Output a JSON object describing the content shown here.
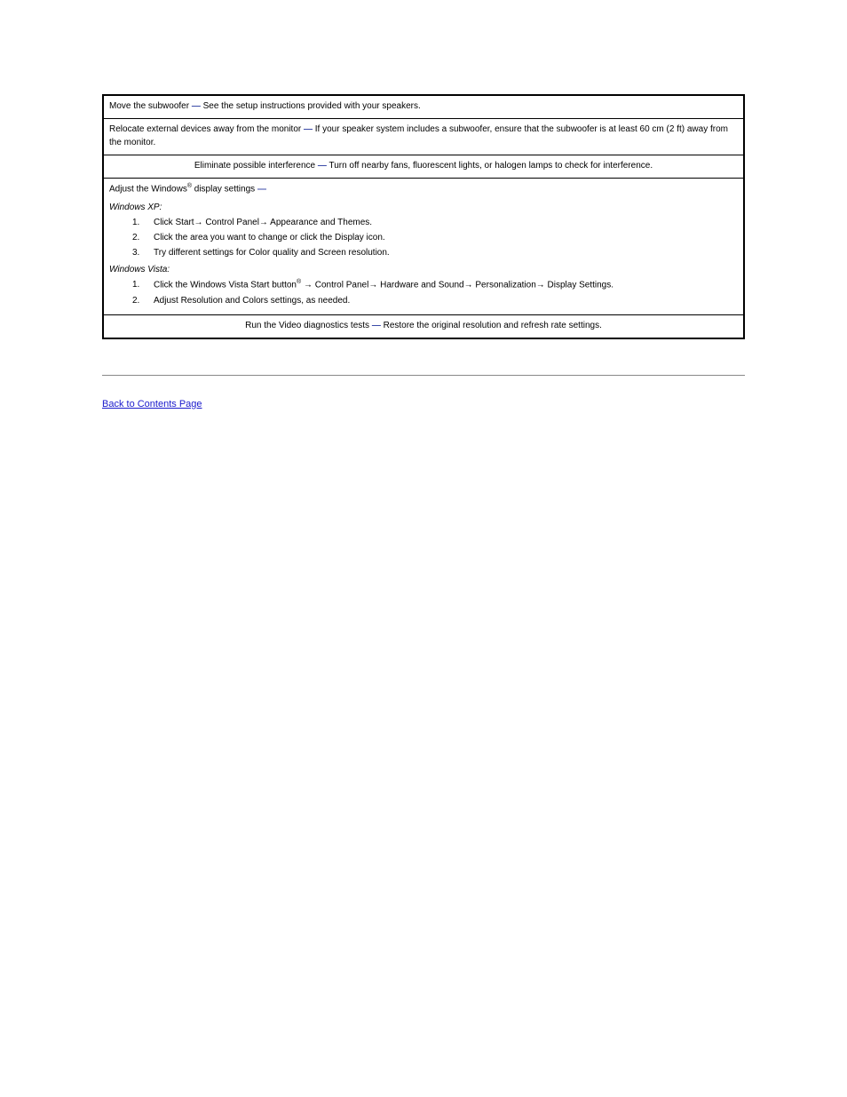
{
  "rows": {
    "r0": {
      "prefix": "Move the subwoofer ",
      "body": " See the setup instructions provided with your speakers."
    },
    "r1": {
      "prefix": "Relocate external devices away from the monitor ",
      "body": " If your speaker system includes a subwoofer, ensure that the subwoofer is at least 60 cm (2 ft) away from the monitor."
    },
    "r2": {
      "prefix": "Eliminate possible interference ",
      "body": " Turn off nearby fans, fluorescent lights, or halogen lamps to check for interference."
    },
    "r3": {
      "prefix_head": "Adjust the Windows",
      "prefix_tail": " display settings ",
      "intro": " ",
      "os_xp": "Windows XP:",
      "xp_steps": [
        "Click Start→ Control Panel→ Appearance and Themes.",
        "Click the area you want to change or click the Display icon.",
        "Try different settings for Color quality and Screen resolution."
      ],
      "os_vista": "Windows Vista:",
      "vista_steps": [
        {
          "pre": "Click the Windows Vista Start button",
          "post": " → Control Panel→ Hardware and Sound→ Personalization→ Display Settings."
        },
        {
          "pre": "",
          "post": "Adjust Resolution and Colors settings, as needed."
        }
      ]
    },
    "r4": {
      "prefix": "Run the Video diagnostics tests ",
      "body": " Restore the original resolution and refresh rate settings."
    }
  },
  "back_link": "Back to Contents Page"
}
